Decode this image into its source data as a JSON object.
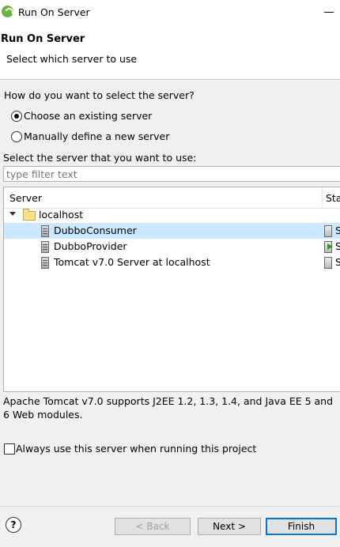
{
  "window": {
    "title": "Run On Server"
  },
  "header": {
    "title": "Run On Server",
    "description": "Select which server to use"
  },
  "question": "How do you want to select the server?",
  "options": {
    "existing": "Choose an existing server",
    "manual": "Manually define a new server"
  },
  "select_label": "Select the server that you want to use:",
  "filter": {
    "value": "",
    "placeholder": "type filter text"
  },
  "table": {
    "columns": {
      "server": "Server",
      "state": "Sta"
    },
    "group": "localhost",
    "rows": [
      {
        "name": "DubboConsumer",
        "state": "S",
        "selected": true
      },
      {
        "name": "DubboProvider",
        "state": "S",
        "selected": false
      },
      {
        "name": "Tomcat v7.0 Server at localhost",
        "state": "S",
        "selected": false
      }
    ]
  },
  "server_description": "Apache Tomcat v7.0 supports J2EE 1.2, 1.3, 1.4, and Java EE 5 and 6 Web modules.",
  "always_use_label": "Always use this server when running this project",
  "buttons": {
    "help": "?",
    "back": "< Back",
    "next": "Next >",
    "finish": "Finish"
  }
}
